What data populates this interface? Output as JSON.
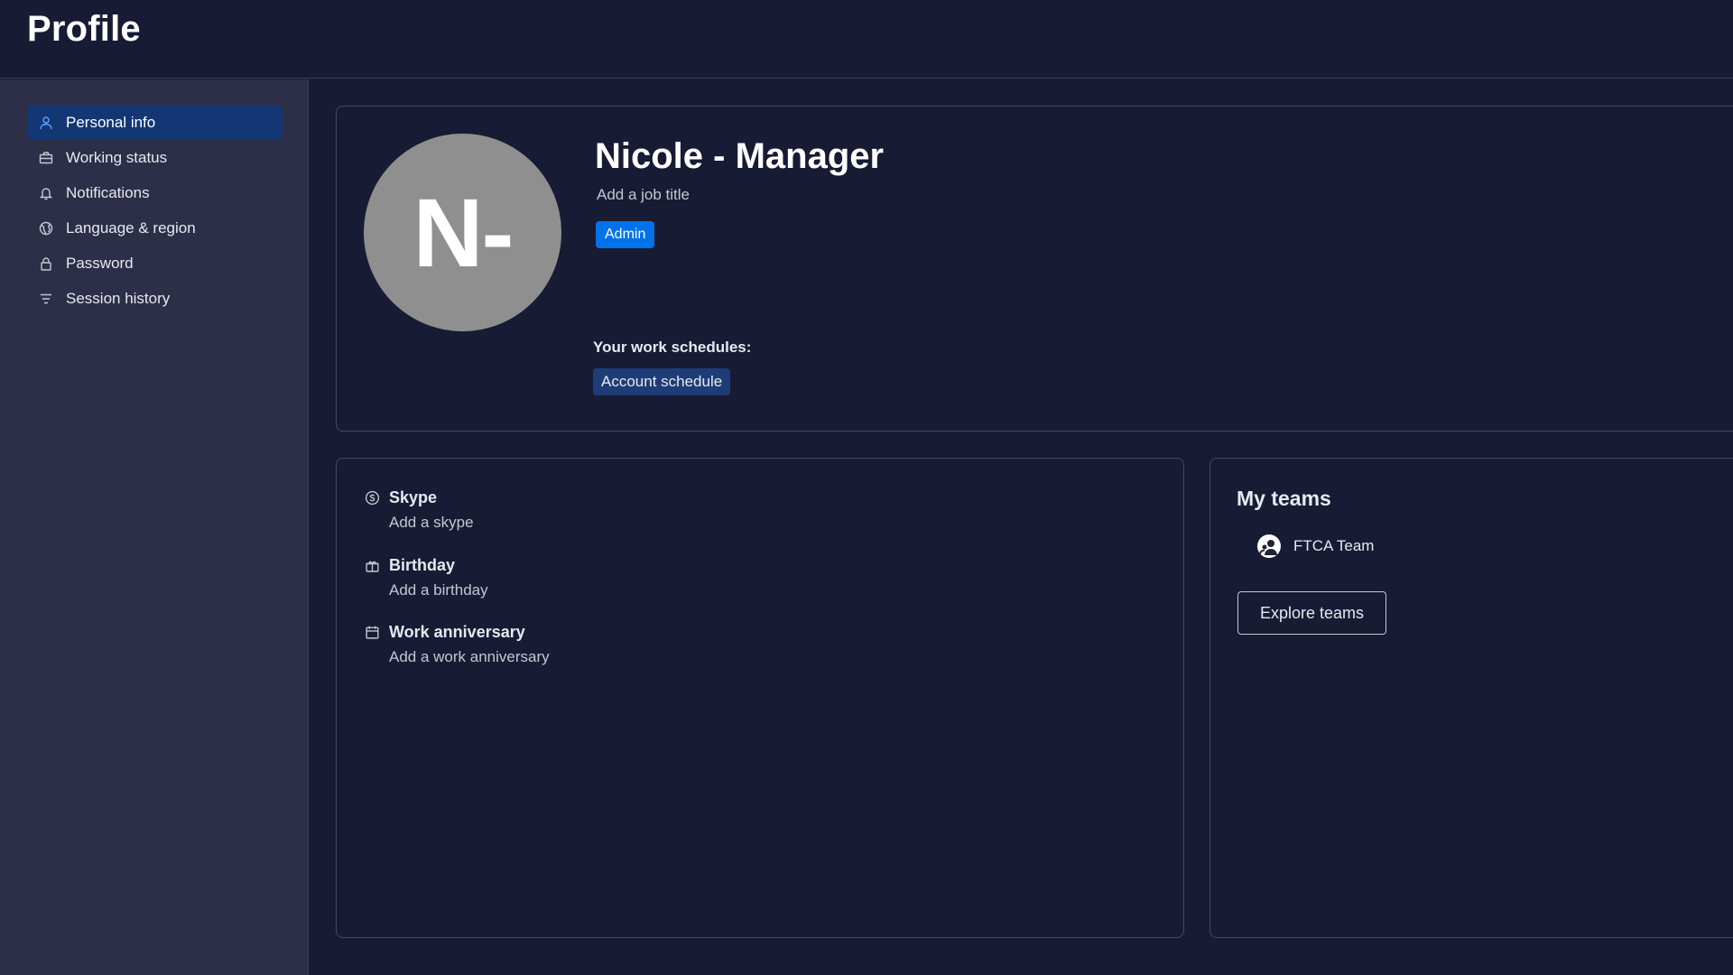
{
  "header": {
    "title": "Profile"
  },
  "sidebar": {
    "items": [
      {
        "label": "Personal info",
        "icon": "person-icon",
        "active": true
      },
      {
        "label": "Working status",
        "icon": "briefcase-icon"
      },
      {
        "label": "Notifications",
        "icon": "bell-icon"
      },
      {
        "label": "Language & region",
        "icon": "globe-icon"
      },
      {
        "label": "Password",
        "icon": "lock-icon"
      },
      {
        "label": "Session history",
        "icon": "filter-lines-icon"
      }
    ]
  },
  "profile": {
    "avatar_initials": "N-",
    "name": "Nicole - Manager",
    "job_title_placeholder": "Add a job title",
    "role_badge": "Admin",
    "schedules_label": "Your work schedules:",
    "schedule": "Account schedule"
  },
  "details": {
    "items": [
      {
        "title": "Skype",
        "value": "Add a skype",
        "icon": "skype-icon"
      },
      {
        "title": "Birthday",
        "value": "Add a birthday",
        "icon": "gift-icon"
      },
      {
        "title": "Work anniversary",
        "value": "Add a work anniversary",
        "icon": "calendar-icon"
      }
    ]
  },
  "teams": {
    "title": "My teams",
    "items": [
      {
        "name": "FTCA Team",
        "icon": "team-icon"
      }
    ],
    "explore_label": "Explore teams"
  },
  "colors": {
    "background": "#181b34",
    "sidebar": "#2d2f48",
    "active_nav": "#133774",
    "accent": "#0073ea",
    "avatar": "#8f8f8f"
  }
}
